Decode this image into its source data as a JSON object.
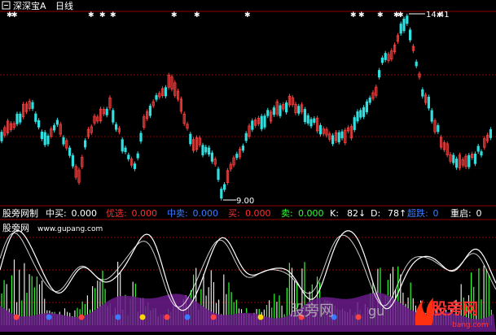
{
  "title_bar": {
    "stock_name": "深深宝A",
    "period": "日线"
  },
  "top_chart": {
    "high_label": "14.41",
    "low_label": "9.00"
  },
  "indicator_bar": {
    "name": "股旁网制",
    "items": [
      {
        "label": "中买:",
        "value": "0.000",
        "color": "#ffffff"
      },
      {
        "label": "优选:",
        "value": "0.000",
        "color": "#ff3030"
      },
      {
        "label": "中卖:",
        "value": "0.000",
        "color": "#3b7bff"
      },
      {
        "label": "买:",
        "value": "0.000",
        "color": "#ff3030"
      },
      {
        "label": "卖:",
        "value": "0.000",
        "color": "#30ff30"
      },
      {
        "label": "K:",
        "value": "82↓",
        "color": "#ffffff"
      },
      {
        "label": "D:",
        "value": "78↑",
        "color": "#ffffff"
      },
      {
        "label": "超跌:",
        "value": "0",
        "color": "#3b7bff"
      },
      {
        "label": "重启:",
        "value": "0",
        "color": "#ffffff"
      }
    ]
  },
  "bottom_panel": {
    "site_name": "股旁网",
    "site_url": "www.gupang.com"
  },
  "watermark": {
    "text_cn": "股旁网",
    "text_en": "gu"
  },
  "logo": {
    "text": "股旁网",
    "sub": "bang.com"
  },
  "colors": {
    "up": "#ff4040",
    "down": "#30e0e0",
    "grid": "#8b0000",
    "green_bar": "#30ff30",
    "purple_area": "#6a1b8a"
  }
}
